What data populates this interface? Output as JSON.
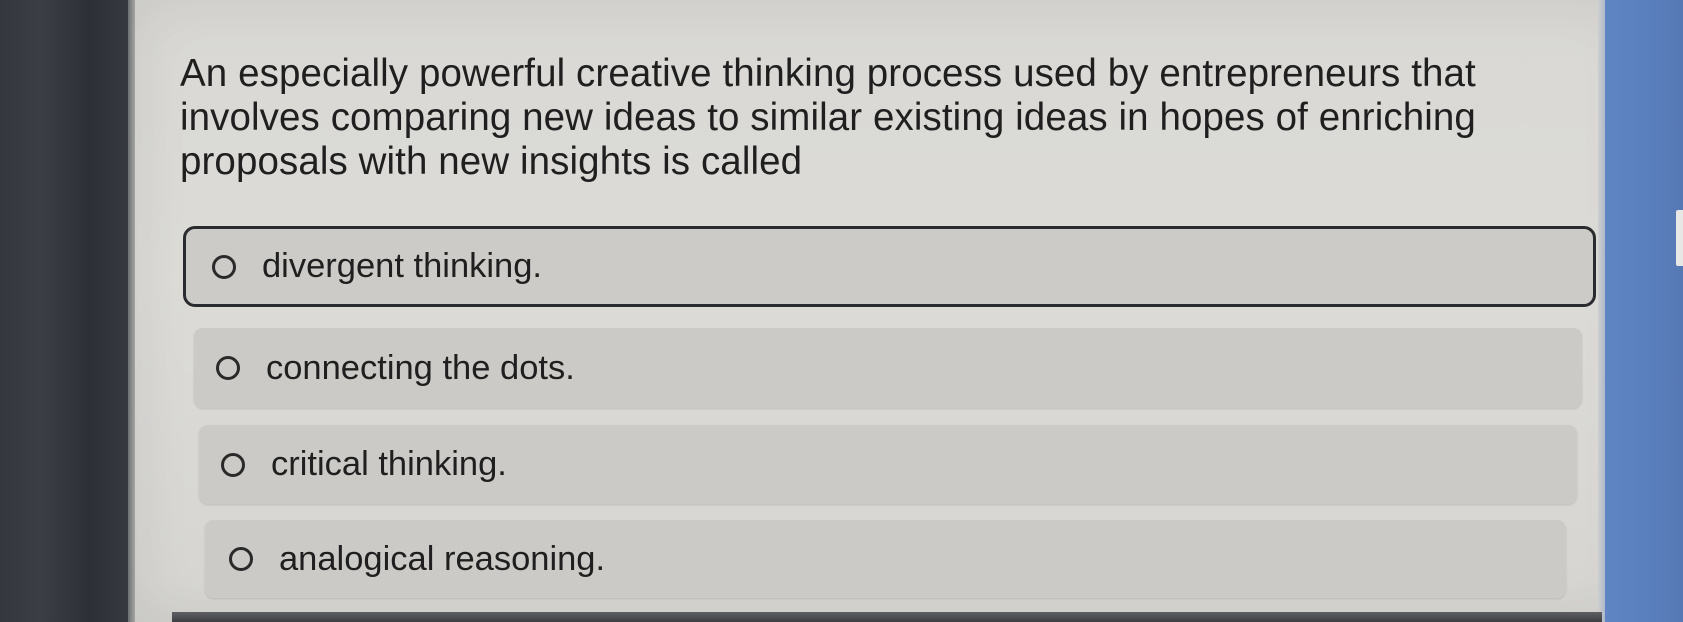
{
  "question": {
    "lines": [
      "An especially powerful creative thinking process used by entrepreneurs that",
      "involves comparing new ideas to similar existing ideas in hopes of enriching",
      "proposals with new insights is called"
    ]
  },
  "options": [
    {
      "label": "divergent thinking.",
      "focused": true,
      "checked": false
    },
    {
      "label": "connecting the dots.",
      "focused": false,
      "checked": false
    },
    {
      "label": "critical thinking.",
      "focused": false,
      "checked": false
    },
    {
      "label": "analogical reasoning.",
      "focused": false,
      "checked": false
    }
  ],
  "colors": {
    "option_bg": "#cbcac6",
    "page_bg": "#d9d8d4",
    "accent_blue": "#5a80be",
    "text": "#1f1f1f"
  }
}
